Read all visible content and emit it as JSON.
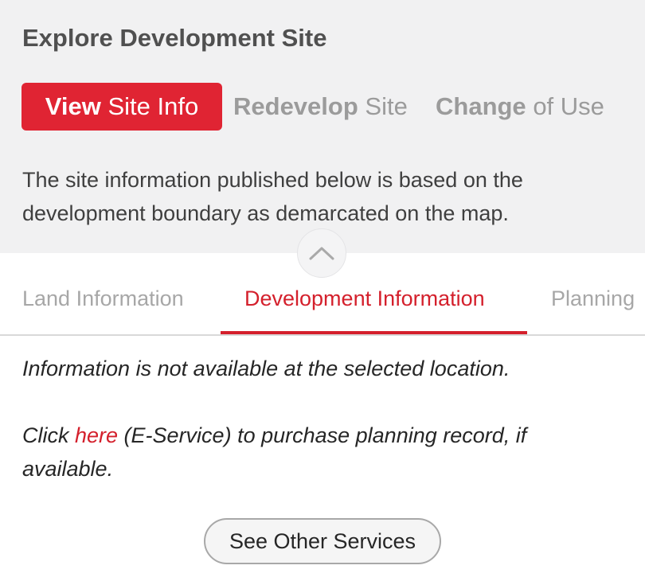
{
  "header": {
    "title": "Explore Development Site"
  },
  "modes": [
    {
      "bold": "View",
      "light": "Site Info",
      "active": true
    },
    {
      "bold": "Redevelop",
      "light": "Site",
      "active": false
    },
    {
      "bold": "Change",
      "light": "of Use",
      "active": false
    }
  ],
  "description": "The site information published below is based on the development boundary as demarcated on the map.",
  "collapse_icon": "chevron-up-icon",
  "tabs": [
    {
      "label": "Land Information",
      "active": false
    },
    {
      "label": "Development Information",
      "active": true
    },
    {
      "label": "Planning",
      "active": false
    }
  ],
  "content": {
    "message": "Information is not available at the selected location.",
    "purchase_prefix": "Click ",
    "purchase_link": "here",
    "purchase_suffix": " (E-Service) to purchase planning record, if available."
  },
  "services_button": "See Other Services",
  "colors": {
    "accent": "#d4202c",
    "active_button": "#e02433",
    "header_bg": "#f1f1f2",
    "inactive_text": "#9b9b9b"
  }
}
